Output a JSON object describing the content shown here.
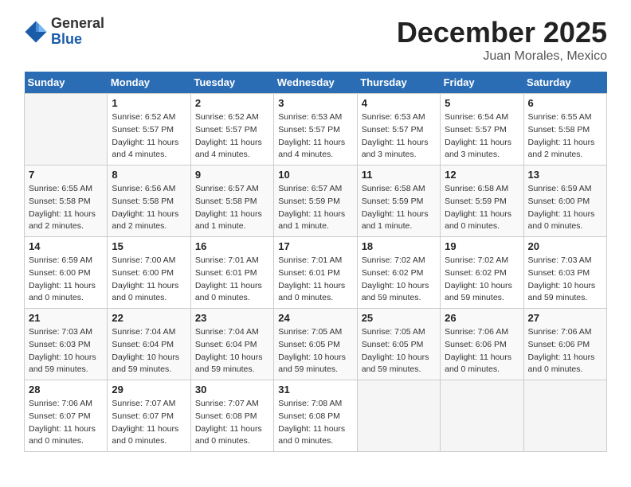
{
  "header": {
    "logo": {
      "general": "General",
      "blue": "Blue"
    },
    "month": "December 2025",
    "location": "Juan Morales, Mexico"
  },
  "calendar": {
    "days_of_week": [
      "Sunday",
      "Monday",
      "Tuesday",
      "Wednesday",
      "Thursday",
      "Friday",
      "Saturday"
    ],
    "weeks": [
      [
        {
          "day": "",
          "info": ""
        },
        {
          "day": "1",
          "info": "Sunrise: 6:52 AM\nSunset: 5:57 PM\nDaylight: 11 hours\nand 4 minutes."
        },
        {
          "day": "2",
          "info": "Sunrise: 6:52 AM\nSunset: 5:57 PM\nDaylight: 11 hours\nand 4 minutes."
        },
        {
          "day": "3",
          "info": "Sunrise: 6:53 AM\nSunset: 5:57 PM\nDaylight: 11 hours\nand 4 minutes."
        },
        {
          "day": "4",
          "info": "Sunrise: 6:53 AM\nSunset: 5:57 PM\nDaylight: 11 hours\nand 3 minutes."
        },
        {
          "day": "5",
          "info": "Sunrise: 6:54 AM\nSunset: 5:57 PM\nDaylight: 11 hours\nand 3 minutes."
        },
        {
          "day": "6",
          "info": "Sunrise: 6:55 AM\nSunset: 5:58 PM\nDaylight: 11 hours\nand 2 minutes."
        }
      ],
      [
        {
          "day": "7",
          "info": "Sunrise: 6:55 AM\nSunset: 5:58 PM\nDaylight: 11 hours\nand 2 minutes."
        },
        {
          "day": "8",
          "info": "Sunrise: 6:56 AM\nSunset: 5:58 PM\nDaylight: 11 hours\nand 2 minutes."
        },
        {
          "day": "9",
          "info": "Sunrise: 6:57 AM\nSunset: 5:58 PM\nDaylight: 11 hours\nand 1 minute."
        },
        {
          "day": "10",
          "info": "Sunrise: 6:57 AM\nSunset: 5:59 PM\nDaylight: 11 hours\nand 1 minute."
        },
        {
          "day": "11",
          "info": "Sunrise: 6:58 AM\nSunset: 5:59 PM\nDaylight: 11 hours\nand 1 minute."
        },
        {
          "day": "12",
          "info": "Sunrise: 6:58 AM\nSunset: 5:59 PM\nDaylight: 11 hours\nand 0 minutes."
        },
        {
          "day": "13",
          "info": "Sunrise: 6:59 AM\nSunset: 6:00 PM\nDaylight: 11 hours\nand 0 minutes."
        }
      ],
      [
        {
          "day": "14",
          "info": "Sunrise: 6:59 AM\nSunset: 6:00 PM\nDaylight: 11 hours\nand 0 minutes."
        },
        {
          "day": "15",
          "info": "Sunrise: 7:00 AM\nSunset: 6:00 PM\nDaylight: 11 hours\nand 0 minutes."
        },
        {
          "day": "16",
          "info": "Sunrise: 7:01 AM\nSunset: 6:01 PM\nDaylight: 11 hours\nand 0 minutes."
        },
        {
          "day": "17",
          "info": "Sunrise: 7:01 AM\nSunset: 6:01 PM\nDaylight: 11 hours\nand 0 minutes."
        },
        {
          "day": "18",
          "info": "Sunrise: 7:02 AM\nSunset: 6:02 PM\nDaylight: 10 hours\nand 59 minutes."
        },
        {
          "day": "19",
          "info": "Sunrise: 7:02 AM\nSunset: 6:02 PM\nDaylight: 10 hours\nand 59 minutes."
        },
        {
          "day": "20",
          "info": "Sunrise: 7:03 AM\nSunset: 6:03 PM\nDaylight: 10 hours\nand 59 minutes."
        }
      ],
      [
        {
          "day": "21",
          "info": "Sunrise: 7:03 AM\nSunset: 6:03 PM\nDaylight: 10 hours\nand 59 minutes."
        },
        {
          "day": "22",
          "info": "Sunrise: 7:04 AM\nSunset: 6:04 PM\nDaylight: 10 hours\nand 59 minutes."
        },
        {
          "day": "23",
          "info": "Sunrise: 7:04 AM\nSunset: 6:04 PM\nDaylight: 10 hours\nand 59 minutes."
        },
        {
          "day": "24",
          "info": "Sunrise: 7:05 AM\nSunset: 6:05 PM\nDaylight: 10 hours\nand 59 minutes."
        },
        {
          "day": "25",
          "info": "Sunrise: 7:05 AM\nSunset: 6:05 PM\nDaylight: 10 hours\nand 59 minutes."
        },
        {
          "day": "26",
          "info": "Sunrise: 7:06 AM\nSunset: 6:06 PM\nDaylight: 11 hours\nand 0 minutes."
        },
        {
          "day": "27",
          "info": "Sunrise: 7:06 AM\nSunset: 6:06 PM\nDaylight: 11 hours\nand 0 minutes."
        }
      ],
      [
        {
          "day": "28",
          "info": "Sunrise: 7:06 AM\nSunset: 6:07 PM\nDaylight: 11 hours\nand 0 minutes."
        },
        {
          "day": "29",
          "info": "Sunrise: 7:07 AM\nSunset: 6:07 PM\nDaylight: 11 hours\nand 0 minutes."
        },
        {
          "day": "30",
          "info": "Sunrise: 7:07 AM\nSunset: 6:08 PM\nDaylight: 11 hours\nand 0 minutes."
        },
        {
          "day": "31",
          "info": "Sunrise: 7:08 AM\nSunset: 6:08 PM\nDaylight: 11 hours\nand 0 minutes."
        },
        {
          "day": "",
          "info": ""
        },
        {
          "day": "",
          "info": ""
        },
        {
          "day": "",
          "info": ""
        }
      ]
    ]
  }
}
